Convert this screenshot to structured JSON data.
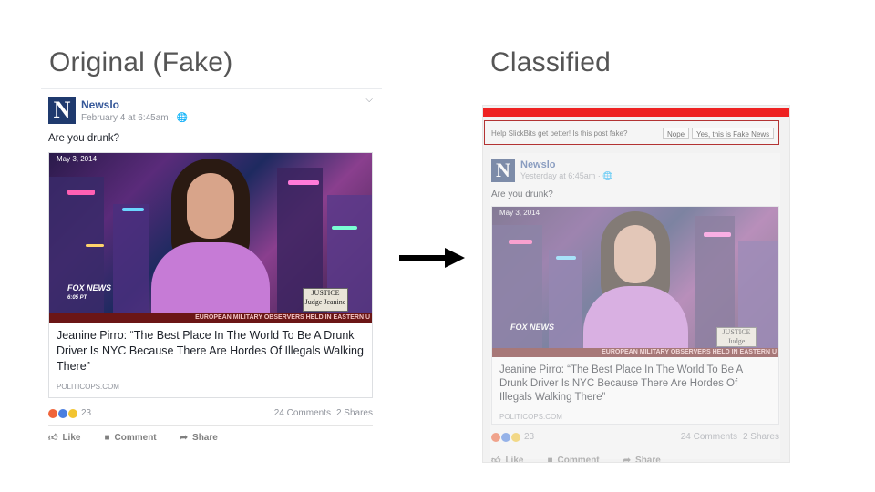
{
  "slide": {
    "title_left": "Original (Fake)",
    "title_right": "Classified"
  },
  "post": {
    "page_name": "Newslo",
    "logo_letter": "N",
    "time_left": "February 4 at 6:45am · ",
    "time_right": "Yesterday at 6:45am · ",
    "privacy_icon": "globe-icon",
    "text": "Are you drunk?",
    "photo": {
      "date_stamp": "May 3, 2014",
      "network": "FOX NEWS",
      "network_time": "6:05 PT",
      "show_logo": "JUSTICE Judge Jeanine",
      "ticker": "EUROPEAN MILITARY OBSERVERS HELD IN EASTERN U"
    },
    "headline": "Jeanine Pirro: “The Best Place In The World To Be A Drunk Driver Is NYC Because There Are Hordes Of Illegals Walking There”",
    "domain": "POLITICOPS.COM",
    "reactions_count": "23",
    "comments": "24 Comments",
    "shares": "2 Shares",
    "actions": {
      "like": "Like",
      "comment": "Comment",
      "share": "Share"
    }
  },
  "classifier": {
    "prompt": "Help SlickBits get better! Is this post fake?",
    "nope_label": "Nope",
    "yes_label": "Yes, this is Fake News",
    "bar_color": "#ee2222"
  },
  "colors": {
    "link": "#365899",
    "logo_bg": "#1f3a6e",
    "title": "#555555"
  }
}
